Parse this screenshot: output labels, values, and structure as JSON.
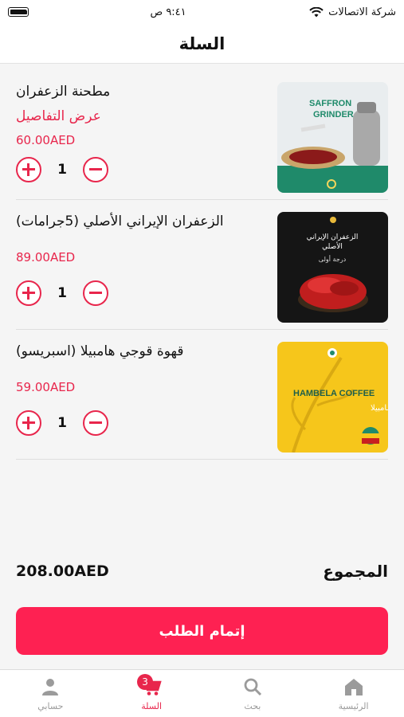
{
  "status_bar": {
    "carrier": "شركة الاتصالات",
    "time": "٩:٤١ ص"
  },
  "header": {
    "title": "السلة"
  },
  "cart": {
    "items": [
      {
        "title": "مطحنة الزعفران",
        "details_label": "عرض التفاصيل",
        "price": "60.00AED",
        "quantity": "1",
        "image_text": [
          "SAFFRON",
          "GRINDER"
        ]
      },
      {
        "title": "الزعفران الإيراني الأصلي (5جرامات)",
        "price": "89.00AED",
        "quantity": "1",
        "image_text": [
          "الزعفران الإيراني",
          "الأصلي",
          "درجة أولى"
        ]
      },
      {
        "title": "قهوة قوجي هامبيلا (اسبريسو)",
        "price": "59.00AED",
        "quantity": "1",
        "image_text": [
          "HAMBELA COFFEE",
          "قهـوة هـامبيلا"
        ]
      }
    ]
  },
  "summary": {
    "total_label": "المجموع",
    "total_amount": "208.00AED",
    "checkout_label": "إتمام الطلب"
  },
  "tabbar": {
    "tabs": [
      {
        "label": "الرئيسية",
        "icon": "home-icon"
      },
      {
        "label": "بحث",
        "icon": "search-icon"
      },
      {
        "label": "السلة",
        "icon": "cart-icon",
        "badge": "3",
        "active": true
      },
      {
        "label": "حسابي",
        "icon": "person-icon"
      }
    ]
  },
  "colors": {
    "accent": "#e8264c",
    "checkout": "#fe2152"
  }
}
